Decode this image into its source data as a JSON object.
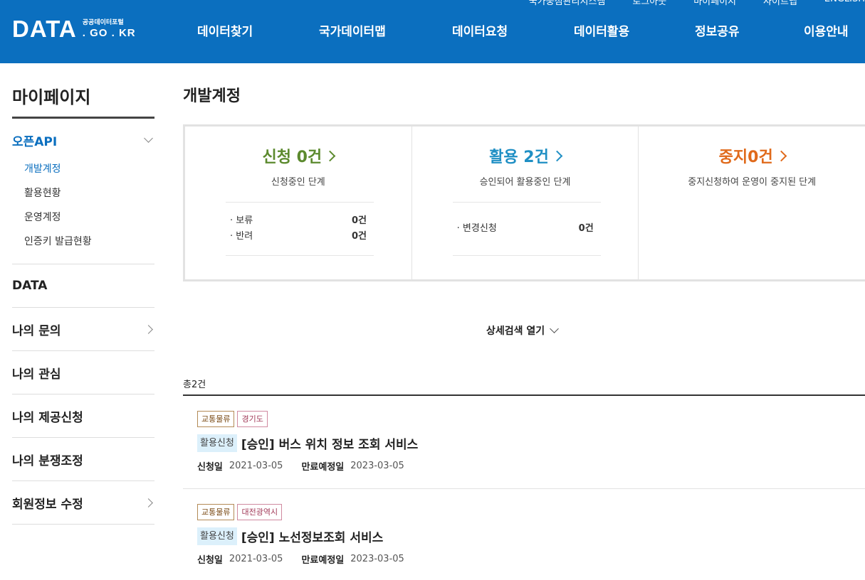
{
  "header": {
    "util_links": [
      "국가중점관리지스템",
      "로그아웃",
      "마이페이지",
      "사이트맵",
      "ENGLISH"
    ],
    "logo_main": "DATA",
    "logo_sub": "공공데이터포털",
    "logo_domain": ". GO . KR",
    "nav": [
      "데이터찾기",
      "국가데이터맵",
      "데이터요청",
      "데이터활용",
      "정보공유",
      "이용안내"
    ]
  },
  "sidebar": {
    "title": "마이페이지",
    "open_api": {
      "label": "오픈API",
      "items": [
        "개발계정",
        "활용현황",
        "운영계정",
        "인증키 발급현황"
      ]
    },
    "items": [
      "DATA",
      "나의 문의",
      "나의 관심",
      "나의 제공신청",
      "나의 분쟁조정",
      "회원정보 수정"
    ]
  },
  "main": {
    "title": "개발계정",
    "stats": [
      {
        "heading": "신청 0건",
        "color": "#5c8a2e",
        "desc": "신청중인 단계",
        "rows": [
          {
            "label": "· 보류",
            "count": "0건"
          },
          {
            "label": "· 반려",
            "count": "0건"
          }
        ]
      },
      {
        "heading": "활용 2건",
        "color": "#1f8fc4",
        "desc": "승인되어 활용중인 단계",
        "rows": [
          {
            "label": "· 변경신청",
            "count": "0건"
          }
        ]
      },
      {
        "heading": "중지0건",
        "color": "#e06a1b",
        "desc": "중지신청하여 운영이 중지된 단계",
        "rows": []
      }
    ],
    "detail_search": "상세검색 열기",
    "total": "총2건",
    "list": [
      {
        "tags": [
          "교통물류",
          "경기도"
        ],
        "badge": "활용신청",
        "title": "[승인] 버스 위치 정보 조회 서비스",
        "apply_label": "신청일",
        "apply_date": "2021-03-05",
        "expire_label": "만료예정일",
        "expire_date": "2023-03-05"
      },
      {
        "tags": [
          "교통물류",
          "대전광역시"
        ],
        "badge": "활용신청",
        "title": "[승인] 노선정보조회 서비스",
        "apply_label": "신청일",
        "apply_date": "2021-03-05",
        "expire_label": "만료예정일",
        "expire_date": "2023-03-05"
      }
    ]
  }
}
